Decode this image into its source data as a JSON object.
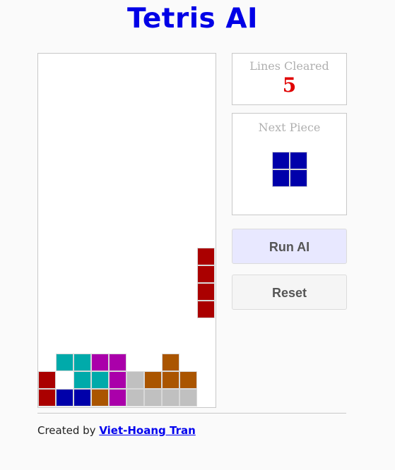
{
  "title": "Tetris AI",
  "colors": {
    "title": "#0000e6",
    "lines_value": "#e00000",
    "cell_border": "#d8d8d8"
  },
  "piece_colors": {
    "R": "#aa0000",
    "T": "#00aaaa",
    "M": "#aa00aa",
    "B": "#0000aa",
    "O": "#aa5500",
    "G": "#c0c0c0"
  },
  "board": {
    "columns": 10,
    "rows": 20,
    "grid": [
      "..........",
      "..........",
      "..........",
      "..........",
      "..........",
      "..........",
      "..........",
      "..........",
      "..........",
      "..........",
      ".........R",
      ".........R",
      ".........R",
      ".........R",
      "..........",
      "..........",
      ".TTMM..O..",
      "R.TTMGOOO.",
      "RBBOMGGGG."
    ]
  },
  "lines_cleared": {
    "label": "Lines Cleared",
    "value": "5"
  },
  "next_piece": {
    "label": "Next Piece",
    "shape": [
      "BB",
      "BB"
    ]
  },
  "buttons": {
    "run_ai": "Run AI",
    "reset": "Reset"
  },
  "footer": {
    "prefix": "Created by",
    "author": "Viet-Hoang Tran"
  }
}
